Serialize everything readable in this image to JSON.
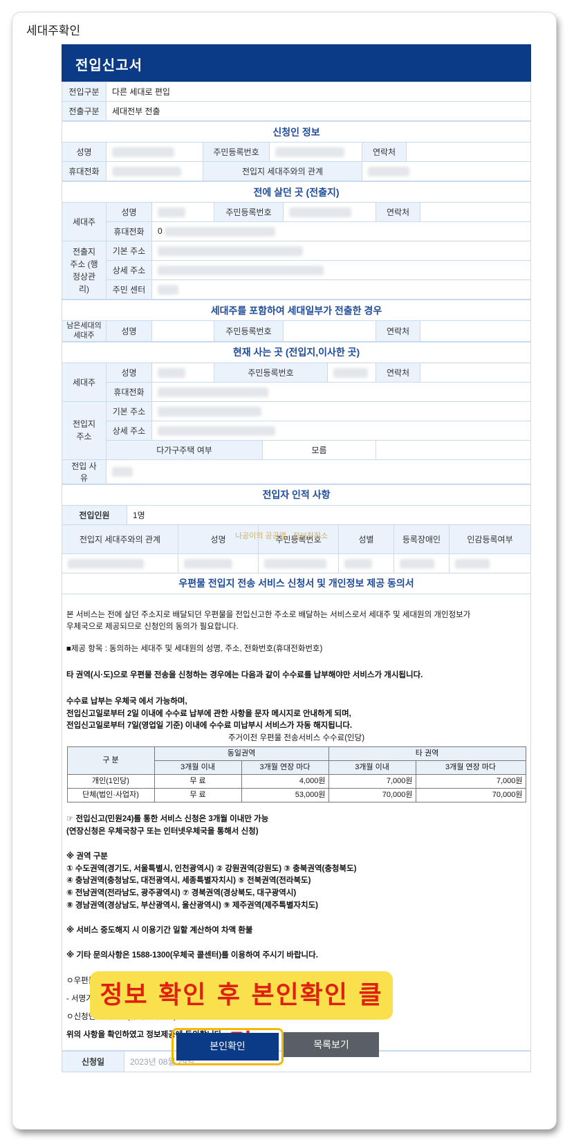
{
  "page_title": "세대주확인",
  "form": {
    "title": "전입신고서",
    "rows": {
      "move_in_type_label": "전입구분",
      "move_in_type_value": "다른 세대로 편입",
      "move_out_type_label": "전출구분",
      "move_out_type_value": "세대전부 전출"
    },
    "applicant": {
      "section": "신청인 정보",
      "name_label": "성명",
      "rrn_label": "주민등록번호",
      "contact_label": "연락처",
      "mobile_label": "휴대전화",
      "relation_label": "전입지 세대주와의 관계"
    },
    "previous": {
      "section": "전에 살던 곳 (전출지)",
      "head_label": "세대주",
      "name_label": "성명",
      "rrn_label": "주민등록번호",
      "contact_label": "연락처",
      "mobile_label": "휴대전화",
      "mobile_prefix": "0",
      "address_group_label": "전출지 주소 (행정상관리)",
      "basic_address_label": "기본 주소",
      "detail_address_label": "상세 주소",
      "center_label": "주민 센터"
    },
    "partial": {
      "section": "세대주를 포함하여 세대일부가 전출한 경우",
      "remaining_head_label": "남은세대의세대주",
      "name_label": "성명",
      "rrn_label": "주민등록번호",
      "contact_label": "연락처"
    },
    "current": {
      "section": "현재 사는 곳 (전입지,이사한 곳)",
      "head_label": "세대주",
      "name_label": "성명",
      "rrn_label": "주민등록번호",
      "contact_label": "연락처",
      "mobile_label": "휴대전화",
      "address_group_label": "전입지 주소",
      "basic_address_label": "기본 주소",
      "detail_address_label": "상세 주소",
      "multi_house_label": "다가구주택 여부",
      "multi_house_value": "모름",
      "reason_label": "전입 사유"
    },
    "persons": {
      "section": "전입자 인적 사항",
      "count_label": "전입인원",
      "count_value": "1명",
      "columns": [
        "전입지 세대주와의 관계",
        "성명",
        "주민등록번호",
        "성별",
        "등록장애인",
        "인감등록여부"
      ]
    },
    "watermark": "나공이의 공공앱 · 정보창작소",
    "consent": {
      "section": "우편물 전입지 전송 서비스 신청서 및 개인정보 제공 동의서",
      "p1_line1": "본 서비스는 전에 살던 주소지로 배달되던 우편물을 전입신고한 주소로 배달하는 서비스로서 세대주 및 세대원의 개인정보가",
      "p1_line2": "우체국으로 제공되므로 신청인의 동의가 필요합니다.",
      "p2": "■제공 항목 : 동의하는 세대주 및 세대원의 성명, 주소, 전화번호(휴대전화번호)",
      "p3": "타 권역(시·도)으로 우편물 전송을 신청하는 경우에는 다음과 같이 수수료를 납부해야만 서비스가 개시됩니다.",
      "p4_line1": "수수료 납부는 우체국 에서 가능하며,",
      "p4_line2": "전입신고일로부터 2일 이내에 수수료 납부에 관한 사항을 문자 메시지로 안내하게 되며,",
      "p4_line3": "전입신고일로부터 7일(영업일 기준) 이내에 수수료 미납부시 서비스가 자동 해지됩니다.",
      "fee_caption": "주거이전 우편물 전송서비스 수수료(인당)",
      "fee_table": {
        "col_type": "구 분",
        "same_region": "동일권역",
        "other_region": "타 권역",
        "within_3m": "3개월 이내",
        "per_3m_ext": "3개월 연장 마다",
        "rows": [
          {
            "type": "개인(1인당)",
            "same_3m": "무 료",
            "same_ext": "4,000원",
            "other_3m": "7,000원",
            "other_ext": "7,000원"
          },
          {
            "type": "단체(법인·사업자)",
            "same_3m": "무 료",
            "same_ext": "53,000원",
            "other_3m": "70,000원",
            "other_ext": "70,000원"
          }
        ]
      },
      "p5_line1": "☞ 전입신고(민원24)를 통한 서비스 신청은 3개월 이내만 가능",
      "p5_line2": "(연장신청은 우체국창구 또는 인터넷우체국을 통해서 신청)",
      "p6_title": "※ 권역 구분",
      "p6_line1": "① 수도권역(경기도, 서울특별시, 인천광역시) ② 강원권역(강원도) ③ 충북권역(충청북도)",
      "p6_line2": "④ 충남권역(충청남도, 대전광역시, 세종특별자치시) ⑤ 전북권역(전라북도)",
      "p6_line3": "⑥ 전남권역(전라남도, 광주광역시) ⑦ 경북권역(경상북도, 대구광역시)",
      "p6_line4": "⑧ 경남권역(경상남도, 부산광역시, 울산광역시) ⑨ 제주권역(제주특별자치도)",
      "p7": "※ 서비스 중도해지 시 이용기간 일할 계산하여 차액 환불",
      "p8": "※ 기타 문의사항은 1588-1300(우체국 콜센터)를 이용하여 주시기 바랍니다.",
      "p9": "ㅇ우편물 전송을 받으려 하는 세대주 및 세대원",
      "p10": " - 서명기재 :",
      "p11": "ㅇ신청인 전화번호(휴대전화번호) :",
      "p12": "위의 사항을 확인하였고 정보제공에 동의합니다.",
      "date_label": "신청일",
      "date_value": "2023년 08월 29일"
    }
  },
  "overlay_text": "정보 확인 후 본인확인 클릭",
  "buttons": {
    "confirm": "본인확인",
    "list": "목록보기"
  }
}
